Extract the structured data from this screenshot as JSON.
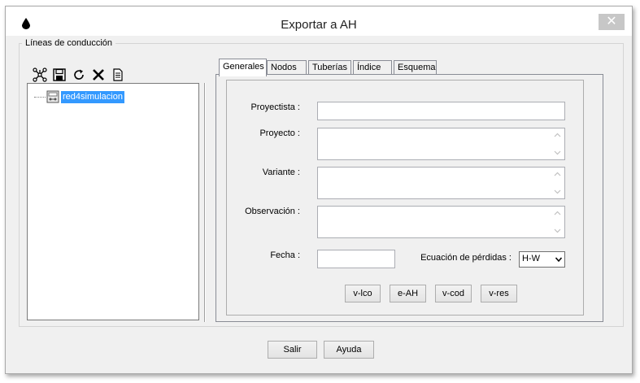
{
  "window": {
    "title": "Exportar a AH",
    "close_label": "✕"
  },
  "group": {
    "title": "Líneas de conducción"
  },
  "toolbar": {
    "icons": [
      "network-icon",
      "save-icon",
      "refresh-icon",
      "delete-icon",
      "document-icon"
    ]
  },
  "tree": {
    "items": [
      {
        "label": "red4simulacion",
        "selected": true
      }
    ]
  },
  "tabs": [
    {
      "label": "Generales",
      "active": true
    },
    {
      "label": "Nodos",
      "active": false
    },
    {
      "label": "Tuberías",
      "active": false
    },
    {
      "label": "Índice",
      "active": false
    },
    {
      "label": "Esquema",
      "active": false
    }
  ],
  "form": {
    "proyectista_label": "Proyectista :",
    "proyectista_value": "",
    "proyecto_label": "Proyecto :",
    "proyecto_value": "",
    "variante_label": "Variante :",
    "variante_value": "",
    "observacion_label": "Observación :",
    "observacion_value": "",
    "fecha_label": "Fecha :",
    "fecha_value": "",
    "ecuacion_label": "Ecuación de pérdidas :",
    "ecuacion_value": "H-W"
  },
  "export_buttons": [
    "v-lco",
    "e-AH",
    "v-cod",
    "v-res"
  ],
  "footer": {
    "salir_label": "Salir",
    "ayuda_label": "Ayuda"
  }
}
